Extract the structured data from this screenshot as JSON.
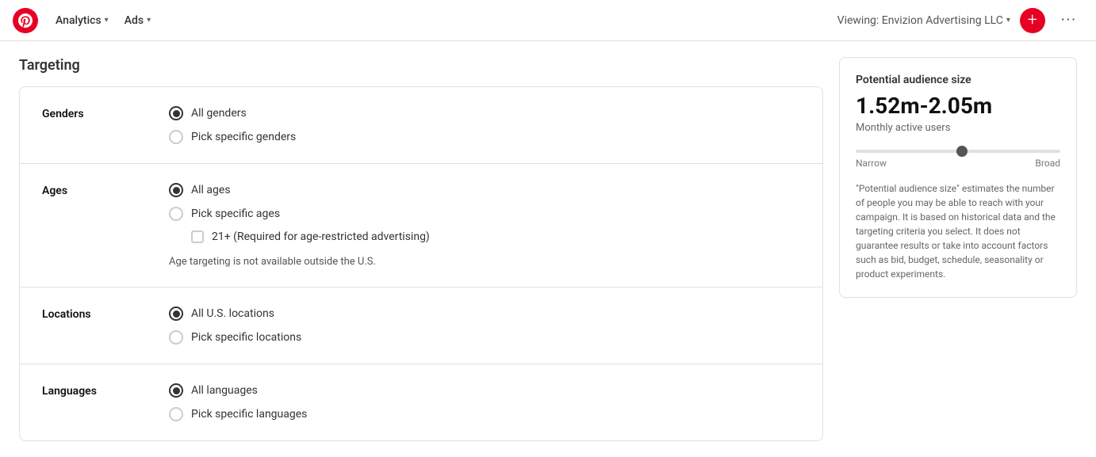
{
  "nav": {
    "analytics_label": "Analytics",
    "ads_label": "Ads",
    "viewing_label": "Viewing: Envizion Advertising LLC",
    "add_icon": "+",
    "more_icon": "···"
  },
  "page": {
    "title": "Targeting"
  },
  "targeting": {
    "sections": [
      {
        "id": "genders",
        "label": "Genders",
        "options": [
          {
            "id": "all-genders",
            "label": "All genders",
            "selected": true
          },
          {
            "id": "specific-genders",
            "label": "Pick specific genders",
            "selected": false
          }
        ]
      },
      {
        "id": "ages",
        "label": "Ages",
        "options": [
          {
            "id": "all-ages",
            "label": "All ages",
            "selected": true
          },
          {
            "id": "specific-ages",
            "label": "Pick specific ages",
            "selected": false
          }
        ],
        "checkbox": {
          "label": "21+ (Required for age-restricted advertising)",
          "checked": false
        },
        "note": "Age targeting is not available outside the U.S."
      },
      {
        "id": "locations",
        "label": "Locations",
        "options": [
          {
            "id": "all-locations",
            "label": "All U.S. locations",
            "selected": true
          },
          {
            "id": "specific-locations",
            "label": "Pick specific locations",
            "selected": false
          }
        ]
      },
      {
        "id": "languages",
        "label": "Languages",
        "options": [
          {
            "id": "all-languages",
            "label": "All languages",
            "selected": true
          },
          {
            "id": "specific-languages",
            "label": "Pick specific languages",
            "selected": false
          }
        ]
      }
    ]
  },
  "audience": {
    "card_title": "Potential audience size",
    "size_value": "1.52m-2.05m",
    "subtitle": "Monthly active users",
    "slider_narrow_label": "Narrow",
    "slider_broad_label": "Broad",
    "description": "\"Potential audience size\" estimates the number of people you may be able to reach with your campaign. It is based on historical data and the targeting criteria you select. It does not guarantee results or take into account factors such as bid, budget, schedule, seasonality or product experiments."
  }
}
